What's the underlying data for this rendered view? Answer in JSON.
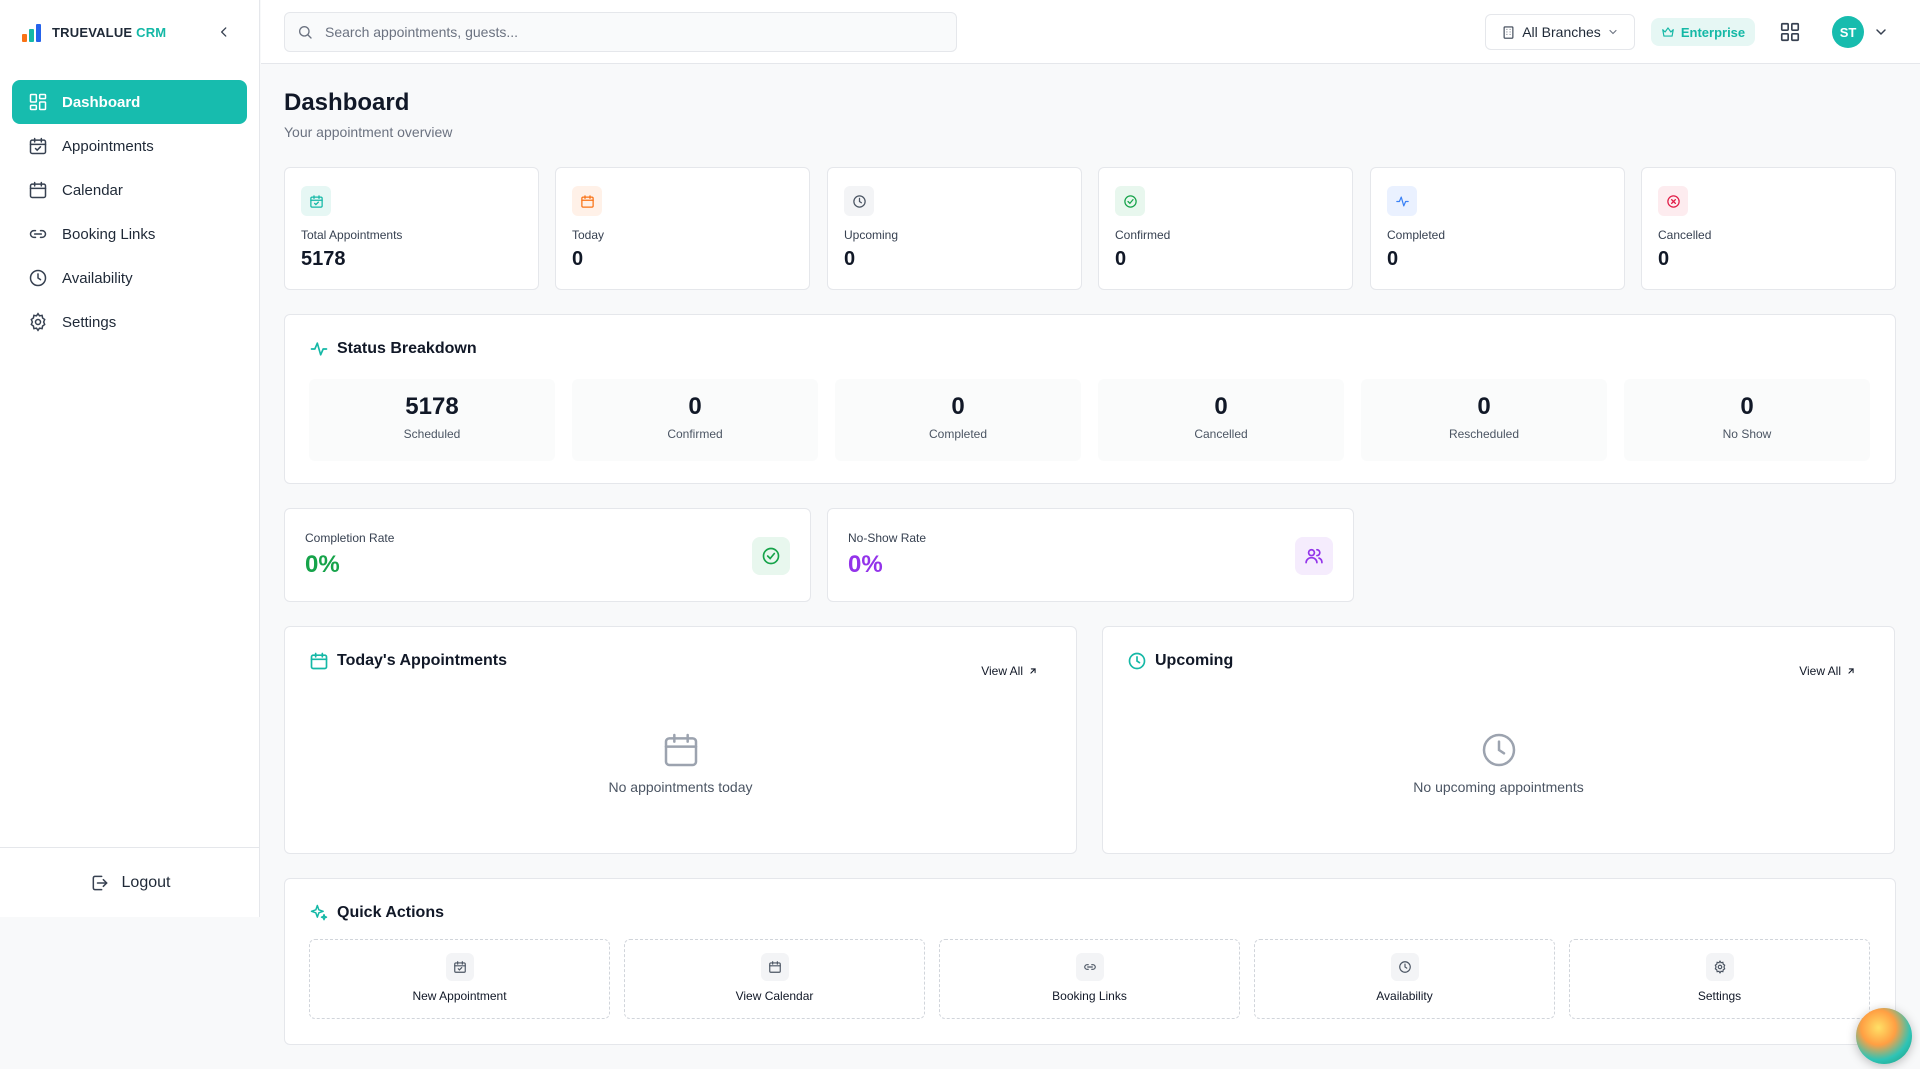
{
  "brand": {
    "name": "TRUEVALUE",
    "suffix": "CRM"
  },
  "sidebar": {
    "items": [
      {
        "label": "Dashboard",
        "icon": "dashboard-icon",
        "active": true
      },
      {
        "label": "Appointments",
        "icon": "calendar-check-icon"
      },
      {
        "label": "Calendar",
        "icon": "calendar-icon"
      },
      {
        "label": "Booking Links",
        "icon": "link-icon"
      },
      {
        "label": "Availability",
        "icon": "clock-icon"
      },
      {
        "label": "Settings",
        "icon": "gear-icon"
      }
    ],
    "logout_label": "Logout"
  },
  "topbar": {
    "search_placeholder": "Search appointments, guests...",
    "branch": "All Branches",
    "plan": "Enterprise",
    "avatar_initials": "ST"
  },
  "header": {
    "title": "Dashboard",
    "subtitle": "Your appointment overview"
  },
  "stats": [
    {
      "label": "Total Appointments",
      "value": "5178",
      "icon": "calendar-check-icon",
      "color": "#14b8a6",
      "bg": "#e6f7f4"
    },
    {
      "label": "Today",
      "value": "0",
      "icon": "calendar-icon",
      "color": "#f97316",
      "bg": "#fff1e8"
    },
    {
      "label": "Upcoming",
      "value": "0",
      "icon": "clock-icon",
      "color": "#4b5563",
      "bg": "#f3f4f6"
    },
    {
      "label": "Confirmed",
      "value": "0",
      "icon": "check-circle-icon",
      "color": "#16a34a",
      "bg": "#e8f7ee"
    },
    {
      "label": "Completed",
      "value": "0",
      "icon": "activity-icon",
      "color": "#3b82f6",
      "bg": "#eaf1ff"
    },
    {
      "label": "Cancelled",
      "value": "0",
      "icon": "x-circle-icon",
      "color": "#e11d48",
      "bg": "#fdecef"
    }
  ],
  "breakdown": {
    "title": "Status Breakdown",
    "items": [
      {
        "value": "5178",
        "label": "Scheduled"
      },
      {
        "value": "0",
        "label": "Confirmed"
      },
      {
        "value": "0",
        "label": "Completed"
      },
      {
        "value": "0",
        "label": "Cancelled"
      },
      {
        "value": "0",
        "label": "Rescheduled"
      },
      {
        "value": "0",
        "label": "No Show"
      }
    ]
  },
  "rates": {
    "completion": {
      "label": "Completion Rate",
      "value": "0%",
      "color": "#16a34a"
    },
    "no_show": {
      "label": "No-Show Rate",
      "value": "0%",
      "color": "#9333ea"
    }
  },
  "today": {
    "title": "Today's Appointments",
    "view_all": "View All",
    "empty": "No appointments today"
  },
  "upcoming": {
    "title": "Upcoming",
    "view_all": "View All",
    "empty": "No upcoming appointments"
  },
  "quick_actions": {
    "title": "Quick Actions",
    "items": [
      {
        "label": "New Appointment",
        "icon": "calendar-plus-icon"
      },
      {
        "label": "View Calendar",
        "icon": "calendar-icon"
      },
      {
        "label": "Booking Links",
        "icon": "link-icon"
      },
      {
        "label": "Availability",
        "icon": "clock-icon"
      },
      {
        "label": "Settings",
        "icon": "gear-icon"
      }
    ]
  },
  "colors": {
    "accent": "#17bcae"
  }
}
